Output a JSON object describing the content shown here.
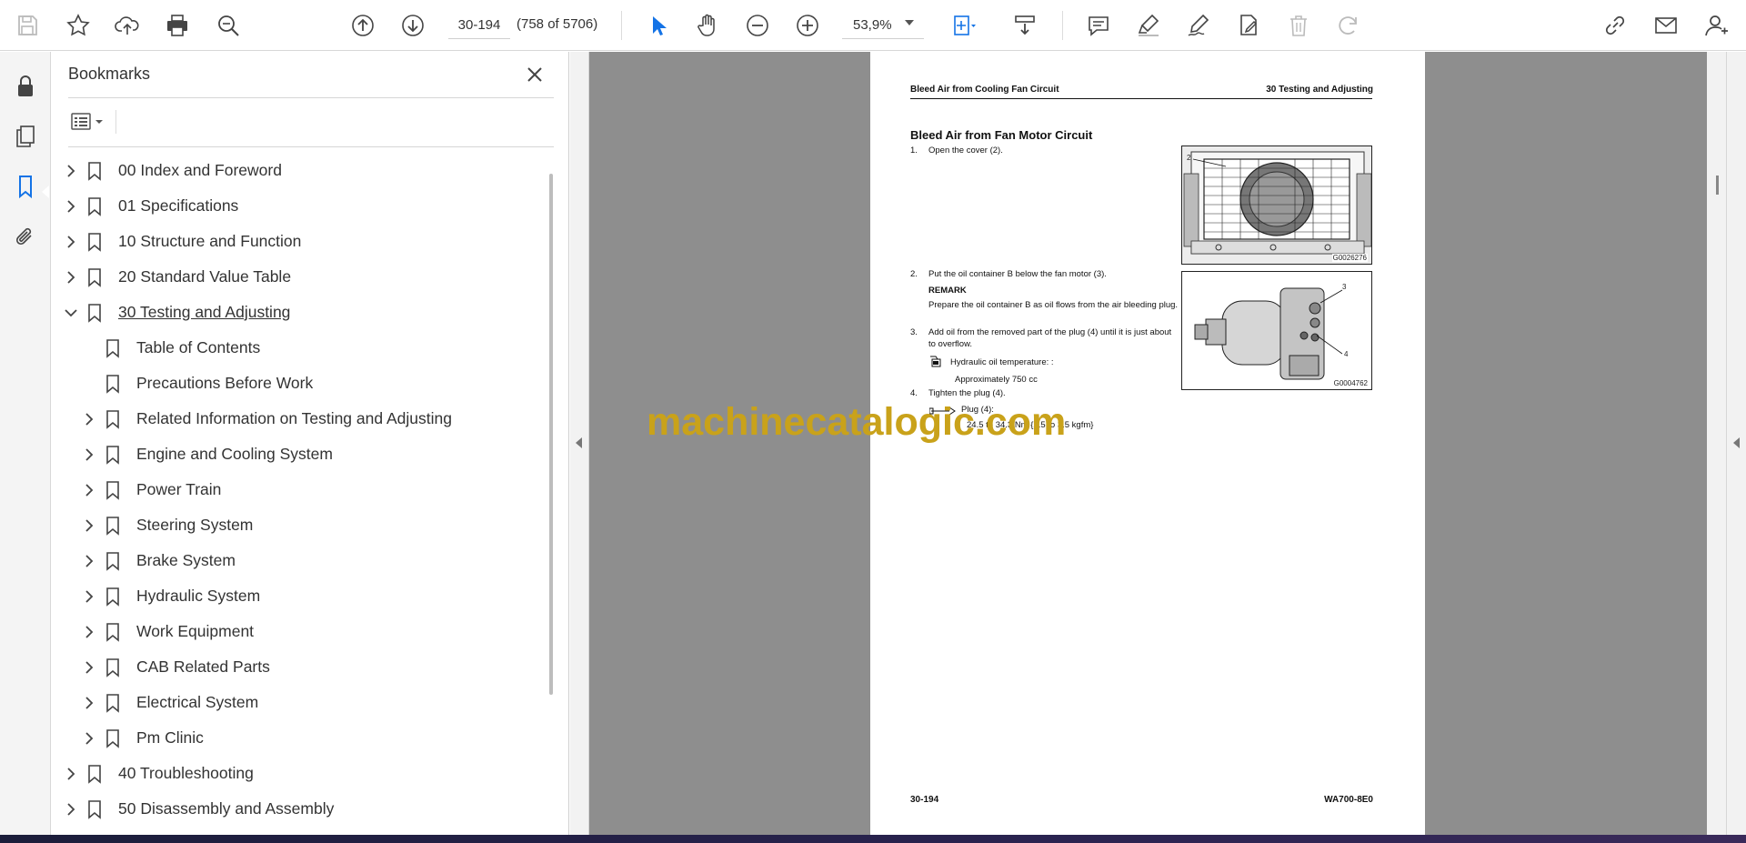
{
  "toolbar": {
    "page_number": "30-194",
    "page_count": "(758 of 5706)",
    "zoom": "53,9%",
    "icons": [
      "save-icon",
      "star-icon",
      "upload-icon",
      "print-icon",
      "find-icon",
      "previous-page-icon",
      "next-page-icon",
      "select-tool-icon",
      "hand-tool-icon",
      "zoom-out-icon",
      "zoom-in-icon",
      "fit-page-icon",
      "scroll-mode-icon",
      "comment-icon",
      "highlight-icon",
      "sign-icon",
      "edit-pdf-icon",
      "delete-icon",
      "redo-icon",
      "share-link-icon",
      "email-icon",
      "account-icon"
    ]
  },
  "rail": {
    "icons": [
      "lock-icon",
      "pages-icon",
      "bookmark-icon",
      "attachment-icon"
    ]
  },
  "bookmarks": {
    "title": "Bookmarks",
    "items": [
      {
        "label": "00 Index and Foreword",
        "level": 0,
        "expandable": true,
        "expanded": false
      },
      {
        "label": "01 Specifications",
        "level": 0,
        "expandable": true,
        "expanded": false
      },
      {
        "label": "10 Structure and Function",
        "level": 0,
        "expandable": true,
        "expanded": false
      },
      {
        "label": "20 Standard Value Table",
        "level": 0,
        "expandable": true,
        "expanded": false
      },
      {
        "label": "30 Testing and Adjusting",
        "level": 0,
        "expandable": true,
        "expanded": true,
        "selected": true
      },
      {
        "label": "Table of Contents",
        "level": 1,
        "expandable": false
      },
      {
        "label": "Precautions Before Work",
        "level": 1,
        "expandable": false
      },
      {
        "label": "Related Information on Testing and Adjusting",
        "level": 1,
        "expandable": true,
        "expanded": false
      },
      {
        "label": "Engine and Cooling System",
        "level": 1,
        "expandable": true,
        "expanded": false
      },
      {
        "label": "Power Train",
        "level": 1,
        "expandable": true,
        "expanded": false
      },
      {
        "label": "Steering System",
        "level": 1,
        "expandable": true,
        "expanded": false
      },
      {
        "label": "Brake System",
        "level": 1,
        "expandable": true,
        "expanded": false
      },
      {
        "label": "Hydraulic System",
        "level": 1,
        "expandable": true,
        "expanded": false
      },
      {
        "label": "Work Equipment",
        "level": 1,
        "expandable": true,
        "expanded": false
      },
      {
        "label": "CAB Related Parts",
        "level": 1,
        "expandable": true,
        "expanded": false
      },
      {
        "label": "Electrical System",
        "level": 1,
        "expandable": true,
        "expanded": false
      },
      {
        "label": "Pm Clinic",
        "level": 1,
        "expandable": true,
        "expanded": false
      },
      {
        "label": "40 Troubleshooting",
        "level": 0,
        "expandable": true,
        "expanded": false
      },
      {
        "label": "50 Disassembly and Assembly",
        "level": 0,
        "expandable": true,
        "expanded": false
      }
    ]
  },
  "page": {
    "header_left": "Bleed Air from Cooling Fan Circuit",
    "header_right": "30 Testing and Adjusting",
    "section_title": "Bleed Air from Fan Motor Circuit",
    "steps": [
      {
        "num": "1.",
        "text": "Open the cover (2)."
      },
      {
        "num": "2.",
        "text": "Put the oil container B below the fan motor (3)."
      },
      {
        "num": "3.",
        "text": "Add oil from the removed part of the plug (4) until it is just about to overflow."
      },
      {
        "num": "4.",
        "text": "Tighten the plug (4)."
      }
    ],
    "remark_title": "REMARK",
    "remark_text": "Prepare the oil container B as oil flows from the air bleeding plug.",
    "oil_label": "Hydraulic oil temperature: :",
    "oil_value": "Approximately 750 cc",
    "plug_label": "Plug (4):",
    "plug_value": "24.5 to 34.3 Nm {2.5 to 3.5 kgfm}",
    "fig1_code": "G0026276",
    "fig1_callout": "2",
    "fig2_code": "G0004762",
    "fig2_callout_a": "3",
    "fig2_callout_b": "4",
    "footer_left": "30-194",
    "footer_right": "WA700-8E0"
  },
  "watermark": "machinecatalogic.com"
}
